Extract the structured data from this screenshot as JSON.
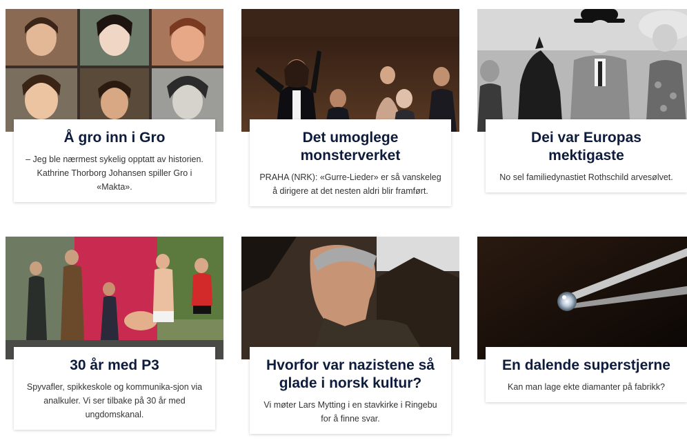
{
  "articles": [
    {
      "title": "Å gro inn i Gro",
      "lede": "– Jeg ble nærmest sykelig opptatt av historien. Kathrine Thorborg Johansen spiller Gro i «Makta».",
      "image": "collage of six portrait photos of a woman"
    },
    {
      "title": "Det umoglege monsterverket",
      "lede": "PRAHA (NRK): «Gurre-Lieder» er så vanskeleg å dirigere at det nesten aldri blir framført.",
      "image": "conductor leading orchestra"
    },
    {
      "title": "Dei var Europas mektigaste",
      "lede": "No sel familiedynastiet Rothschild arvesølvet.",
      "image": "black and white photo of people with horse"
    },
    {
      "title": "30 år med P3",
      "lede": "Spyvafler, spikkeskole og kommunika-sjon via analkuler. Vi ser tilbake på 30 år med ungdomskanal.",
      "image": "outdoor stage with performers"
    },
    {
      "title": "Hvorfor var nazistene så glade i norsk kultur?",
      "lede": "Vi møter Lars Mytting i en stavkirke i Ringebu for å finne svar.",
      "image": "man in profile in front of stave church"
    },
    {
      "title": "En dalende superstjerne",
      "lede": "Kan man lage ekte diamanter på fabrikk?",
      "image": "diamond held by tweezers"
    }
  ]
}
